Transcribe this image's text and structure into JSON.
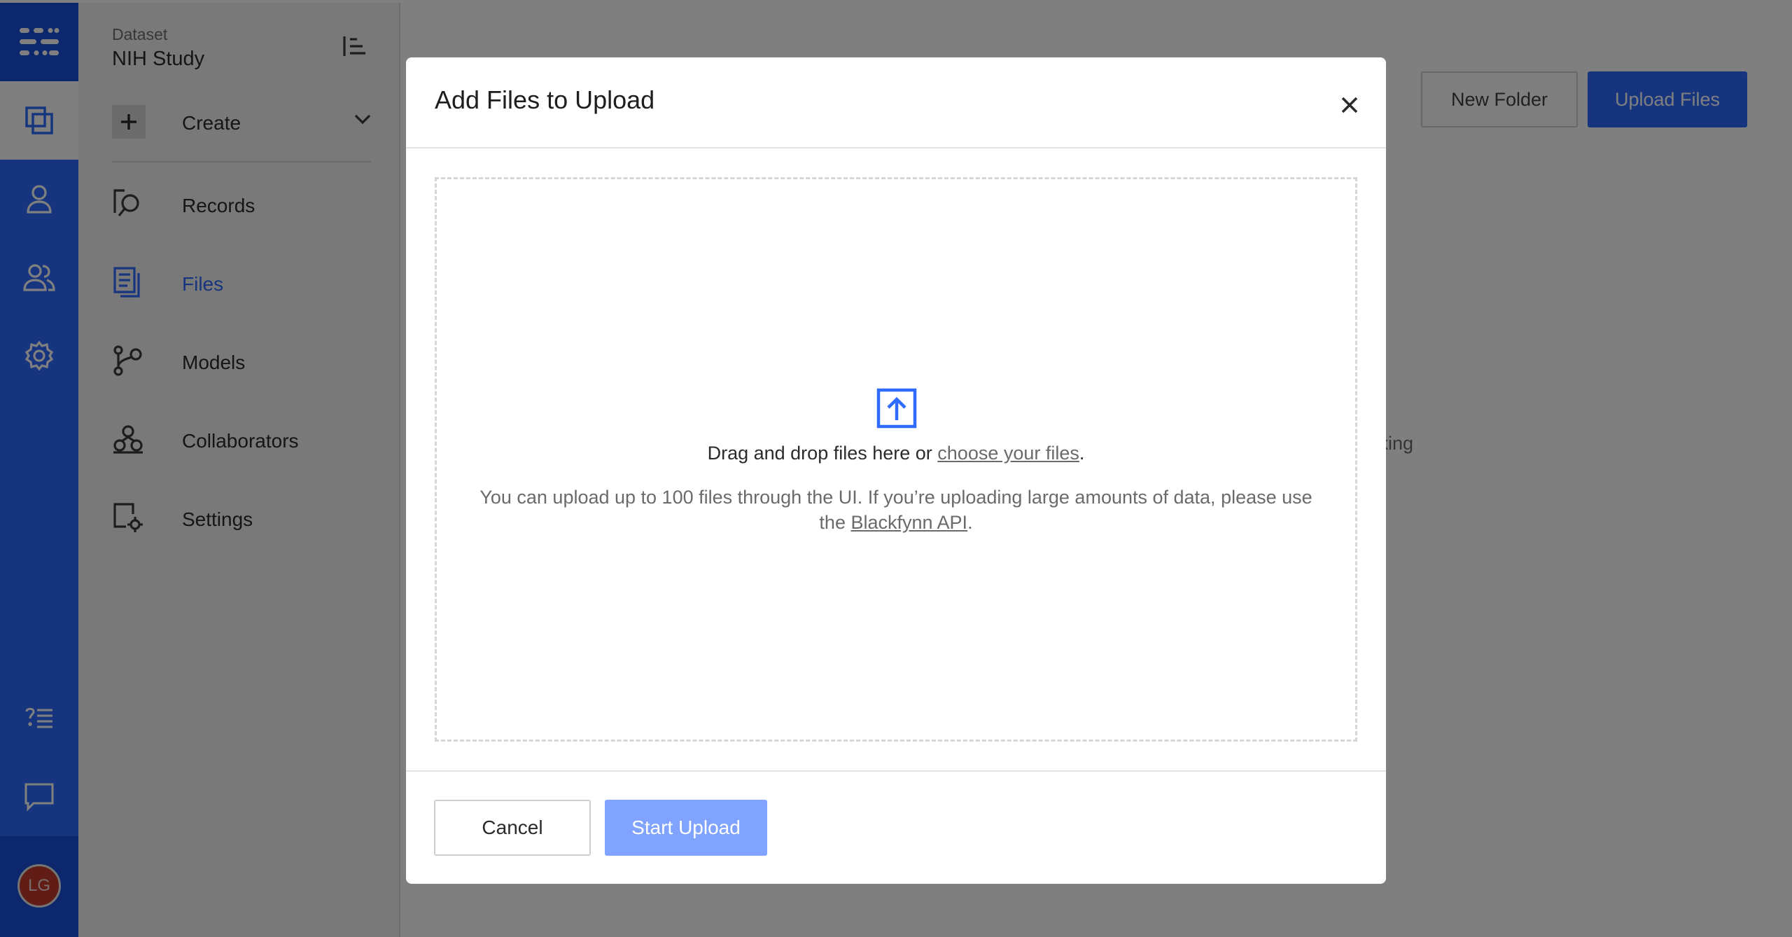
{
  "sidebar": {
    "dataset_label": "Dataset",
    "dataset_name": "NIH Study",
    "create_label": "Create",
    "items": [
      {
        "label": "Records"
      },
      {
        "label": "Files"
      },
      {
        "label": "Models"
      },
      {
        "label": "Collaborators"
      },
      {
        "label": "Settings"
      }
    ],
    "active_item": "Files",
    "user_initials": "LG"
  },
  "page": {
    "new_folder_label": "New Folder",
    "upload_files_label": "Upload Files",
    "background_text": "icking"
  },
  "modal": {
    "title": "Add Files to Upload",
    "drop_text": "Drag and drop files here or ",
    "choose_link": "choose your files",
    "period": ".",
    "info_text": "You can upload up to 100 files through the UI. If you’re uploading large amounts of data, please use the ",
    "api_link": "Blackfynn API",
    "period2": ".",
    "cancel_label": "Cancel",
    "start_label": "Start Upload"
  },
  "colors": {
    "brand_blue": "#2f6bff",
    "brand_dark_blue": "#1a4fd8",
    "start_disabled": "#7fa3ff",
    "avatar_red": "#c0392b"
  },
  "icons": {
    "rail": [
      "app-logo-icon",
      "datasets-icon",
      "person-icon",
      "people-icon",
      "gear-icon",
      "help-list-icon",
      "chat-icon"
    ],
    "sidebar": [
      "records-icon",
      "files-icon",
      "models-icon",
      "collaborators-icon",
      "settings-icon"
    ],
    "modal": [
      "close-icon",
      "upload-icon"
    ]
  }
}
